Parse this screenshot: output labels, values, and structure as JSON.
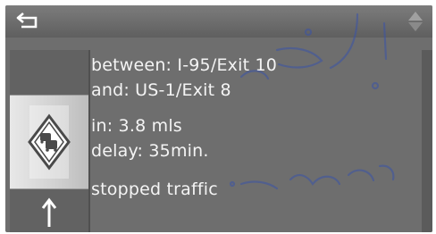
{
  "header": {
    "back_icon": "back-arrow-icon",
    "scroll_icon": "up-down-scroll-icon"
  },
  "sidebar": {
    "selected_icon": "traffic-jam-warning-icon",
    "next_icon": "straight-arrow-icon"
  },
  "message": {
    "between": "between: I-95/Exit 10",
    "and": "and: US-1/Exit 8",
    "in": "in: 3.8 mls",
    "delay": "delay: 35min.",
    "status": "stopped traffic"
  },
  "colors": {
    "background": "#6e6e6e",
    "text": "#f4f4f4",
    "watermark": "#3a53a8"
  }
}
